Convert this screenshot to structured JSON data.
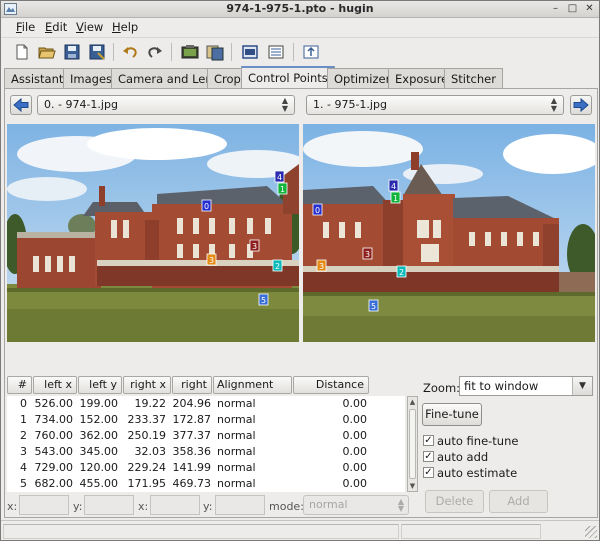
{
  "window": {
    "title": "974-1-975-1.pto - hugin"
  },
  "menu": [
    {
      "label": "File",
      "key": "F",
      "rest": "ile"
    },
    {
      "label": "Edit",
      "key": "E",
      "rest": "dit"
    },
    {
      "label": "View",
      "key": "V",
      "rest": "iew"
    },
    {
      "label": "Help",
      "key": "H",
      "rest": "elp"
    }
  ],
  "toolbar_icons": [
    "new-icon",
    "open-icon",
    "save-icon",
    "save-as-icon",
    "undo-icon",
    "redo-icon",
    "preview-icon",
    "fast-preview-icon",
    "control-points-table-icon",
    "image-properties-icon",
    "optimize-icon"
  ],
  "tabs": [
    {
      "label": "Assistant",
      "active": false
    },
    {
      "label": "Images",
      "active": false
    },
    {
      "label": "Camera and Lens",
      "active": false
    },
    {
      "label": "Crop",
      "active": false
    },
    {
      "label": "Control Points",
      "active": true
    },
    {
      "label": "Optimizer",
      "active": false
    },
    {
      "label": "Exposure",
      "active": false
    },
    {
      "label": "Stitcher",
      "active": false
    }
  ],
  "left_image": {
    "selected": "0. - 974-1.jpg"
  },
  "right_image": {
    "selected": "1. - 975-1.jpg"
  },
  "control_points_markers": [
    "0",
    "1",
    "2",
    "3",
    "4",
    "5"
  ],
  "table": {
    "columns": [
      "#",
      "left x",
      "left y",
      "right x",
      "right y",
      "Alignment",
      "Distance"
    ],
    "rows": [
      {
        "n": "0",
        "lx": "526.00",
        "ly": "199.00",
        "rx": "19.22",
        "ry": "204.96",
        "align": "normal",
        "dist": "0.00"
      },
      {
        "n": "1",
        "lx": "734.00",
        "ly": "152.00",
        "rx": "233.37",
        "ry": "172.87",
        "align": "normal",
        "dist": "0.00"
      },
      {
        "n": "2",
        "lx": "760.00",
        "ly": "362.00",
        "rx": "250.19",
        "ry": "377.37",
        "align": "normal",
        "dist": "0.00"
      },
      {
        "n": "3",
        "lx": "543.00",
        "ly": "345.00",
        "rx": "32.03",
        "ry": "358.36",
        "align": "normal",
        "dist": "0.00"
      },
      {
        "n": "4",
        "lx": "729.00",
        "ly": "120.00",
        "rx": "229.24",
        "ry": "141.99",
        "align": "normal",
        "dist": "0.00"
      },
      {
        "n": "5",
        "lx": "682.00",
        "ly": "455.00",
        "rx": "171.95",
        "ry": "469.73",
        "align": "normal",
        "dist": "0.00"
      }
    ]
  },
  "coords": {
    "x1_label": "x:",
    "y1_label": "y:",
    "x2_label": "x:",
    "y2_label": "y:",
    "mode_label": "mode:",
    "mode_value": "normal"
  },
  "zoom": {
    "label": "Zoom:",
    "value": "fit to window"
  },
  "buttons": {
    "fine_tune": "Fine-tune",
    "delete": "Delete",
    "add": "Add"
  },
  "checks": [
    {
      "label": "auto fine-tune",
      "checked": true
    },
    {
      "label": "auto add",
      "checked": true
    },
    {
      "label": "auto estimate",
      "checked": true
    }
  ],
  "colors": {
    "tab_accent": "#6a8fc4",
    "nav_arrow": "#3a6fc4"
  }
}
